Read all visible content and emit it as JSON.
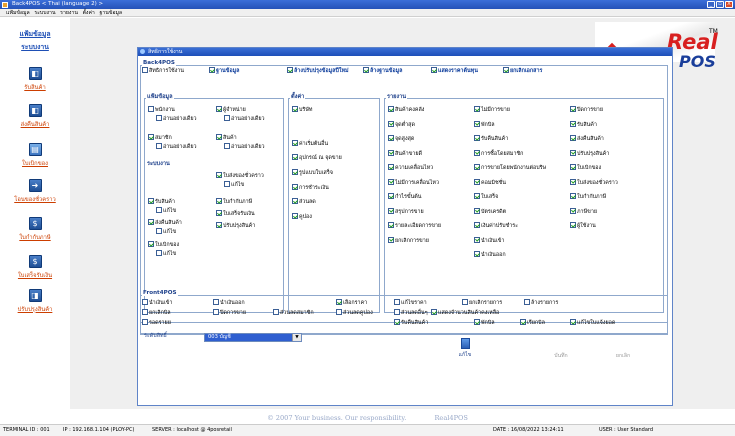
{
  "window": {
    "title": "Back4POS < Thai (language 2) >",
    "min": "_",
    "max": "▫",
    "close": "X"
  },
  "menu": [
    "แฟ้มข้อมูล",
    "ระบบงาน",
    "รายงาน",
    "ตั้งค่า",
    "ฐานข้อมูล"
  ],
  "sidebar": {
    "header1": "แฟ้มข้อมูล",
    "header2": "ระบบงาน",
    "items": [
      "รับสินค้า",
      "ส่งคืนสินค้า",
      "ใบเบิกของ",
      "โอนของชั่วคราว",
      "ใบกำกับภาษี",
      "ใบเสร็จรับเงิน",
      "ปรับปรุงสินค้า"
    ]
  },
  "logo": {
    "text": "Real",
    "text2": "POS",
    "tm": "TM"
  },
  "dialog": {
    "title": "สิทธิการใช้งาน",
    "back4pos": {
      "section": "Back4POS",
      "top_row": [
        {
          "label": "สิทธิการใช้งาน",
          "on": false
        },
        {
          "label": "ฐานข้อมูล",
          "on": true
        },
        {
          "label": "ล้างปรับปรุงข้อมูลปีใหม่",
          "on": true
        },
        {
          "label": "ล้างฐานข้อมูล",
          "on": true
        },
        {
          "label": "แสดงราคาต้นทุน",
          "on": true
        },
        {
          "label": "ยกเลิกเอกสาร",
          "on": true
        }
      ],
      "file_section": "แฟ้มข้อมูล",
      "file_items": [
        {
          "label": "พนักงาน",
          "on": false
        },
        {
          "label": "ผู้จำหน่าย",
          "on": true
        },
        {
          "label": "อ่านอย่างเดียว",
          "on": false
        },
        {
          "label": "อ่านอย่างเดียว",
          "on": false
        },
        {
          "label": "สมาชิก",
          "on": true
        },
        {
          "label": "สินค้า",
          "on": true
        },
        {
          "label": "อ่านอย่างเดียว",
          "on": false
        },
        {
          "label": "อ่านอย่างเดียว",
          "on": false
        }
      ],
      "sys_section": "ระบบงาน",
      "sys_items": [
        {
          "label": "ใบส่งของชั่วคราว",
          "on": true
        },
        {
          "label": "แก้ไข",
          "on": false
        },
        {
          "label": "รับสินค้า",
          "on": true
        },
        {
          "label": "ใบกำกับภาษี",
          "on": true
        },
        {
          "label": "แก้ไข",
          "on": false
        },
        {
          "label": "ใบเสร็จรับเงิน",
          "on": true
        },
        {
          "label": "ส่งคืนสินค้า",
          "on": true
        },
        {
          "label": "ปรับปรุงสินค้า",
          "on": true
        },
        {
          "label": "แก้ไข",
          "on": false
        },
        {
          "label": "ใบเบิกของ",
          "on": true
        },
        {
          "label": "แก้ไข",
          "on": false
        }
      ],
      "settings_section": "ตั้งค่า",
      "settings_items": [
        {
          "label": "บริษัท",
          "on": true
        },
        {
          "label": "ค่าเริ่มต้นอื่น",
          "on": true
        },
        {
          "label": "อุปกรณ์ ณ จุดขาย",
          "on": true
        },
        {
          "label": "รูปแบบใบเสร็จ",
          "on": true
        },
        {
          "label": "การชำระเงิน",
          "on": true
        },
        {
          "label": "ส่วนลด",
          "on": true
        },
        {
          "label": "คูปอง",
          "on": true
        }
      ],
      "report_section": "รายงาน",
      "report_col1": [
        {
          "label": "สินค้าคงคลัง",
          "on": true
        },
        {
          "label": "จุดต่ำสุด",
          "on": true
        },
        {
          "label": "จุดสูงสุด",
          "on": true
        },
        {
          "label": "สินค้าขายดี",
          "on": true
        },
        {
          "label": "ความเคลื่อนไหว",
          "on": true
        },
        {
          "label": "ไม่มีการเคลื่อนไหว",
          "on": true
        },
        {
          "label": "กำไรขั้นต้น",
          "on": true
        },
        {
          "label": "สรุปการขาย",
          "on": true
        },
        {
          "label": "รายละเอียดการขาย",
          "on": true
        },
        {
          "label": "ยกเลิกการขาย",
          "on": true
        }
      ],
      "report_col2": [
        {
          "label": "ไม่มีการขาย",
          "on": true
        },
        {
          "label": "พักบิล",
          "on": true
        },
        {
          "label": "รับคืนสินค้า",
          "on": true
        },
        {
          "label": "การซื้อโดยสมาชิก",
          "on": true
        },
        {
          "label": "การขายโดยพนักงานต่อบริษ",
          "on": true
        },
        {
          "label": "คอมมิชชั่น",
          "on": true
        },
        {
          "label": "ใบเสร็จ",
          "on": true
        },
        {
          "label": "บัตรเครดิต",
          "on": true
        },
        {
          "label": "เงินค่าปรับชำระ",
          "on": true
        },
        {
          "label": "นำเงินเข้า",
          "on": true
        },
        {
          "label": "นำเงินออก",
          "on": true
        }
      ],
      "report_col3": [
        {
          "label": "ปิดการขาย",
          "on": true
        },
        {
          "label": "รับสินค้า",
          "on": true
        },
        {
          "label": "ส่งคืนสินค้า",
          "on": true
        },
        {
          "label": "ปรับปรุงสินค้า",
          "on": true
        },
        {
          "label": "ใบเบิกของ",
          "on": true
        },
        {
          "label": "ใบส่งของชั่วคราว",
          "on": true
        },
        {
          "label": "ใบกำกับภาษี",
          "on": true
        },
        {
          "label": "ภาษีขาย",
          "on": true
        },
        {
          "label": "ผู้ใช้งาน",
          "on": true
        }
      ]
    },
    "front4pos": {
      "section": "Front4POS",
      "row1": [
        {
          "label": "นำเงินเข้า",
          "on": false
        },
        {
          "label": "นำเงินออก",
          "on": false
        },
        {
          "label": "เลือกราคา",
          "on": true
        },
        {
          "label": "แก้ไขราคา",
          "on": false
        },
        {
          "label": "ยกเลิกรายการ",
          "on": false
        },
        {
          "label": "ล้างรายการ",
          "on": false
        }
      ],
      "row2": [
        {
          "label": "ยกเลิกบิล",
          "on": false
        },
        {
          "label": "ปิดการขาย",
          "on": false
        },
        {
          "label": "ส่วนลดสมาชิก",
          "on": false
        },
        {
          "label": "ส่วนลดคูปอง",
          "on": false
        },
        {
          "label": "ส่วนลดอื่นๆ",
          "on": false
        },
        {
          "label": "แสดงจำนวนสินค้าคงเหลือ",
          "on": true
        }
      ],
      "row3": [
        {
          "label": "รอดรายย",
          "on": false
        },
        {
          "label": "รับคืนสินค้า",
          "on": true
        },
        {
          "label": "พักบิล",
          "on": true
        },
        {
          "label": "เรียกบิล",
          "on": true
        },
        {
          "label": "แก้ไขใบแจ้งยอด",
          "on": true
        }
      ]
    },
    "level_label": "ระดับสิทธิ์",
    "level_value": "003 บัญชี",
    "save_label": "แก้ไข",
    "ok_label": "บันทึก",
    "cancel_label": "ยกเลิก"
  },
  "footer": {
    "slogan": "© 2007 Your business. Our responsibility.",
    "brand": "Real4POS"
  },
  "status": {
    "terminal": "TERMINAL ID : 001",
    "ip": "IP : 192.168.1.104 (PLOY-PC)",
    "server": "SERVER : localhost @ 4posretail",
    "date": "DATE : 16/08/2022 13:24:11",
    "user": "USER : User Standard"
  }
}
